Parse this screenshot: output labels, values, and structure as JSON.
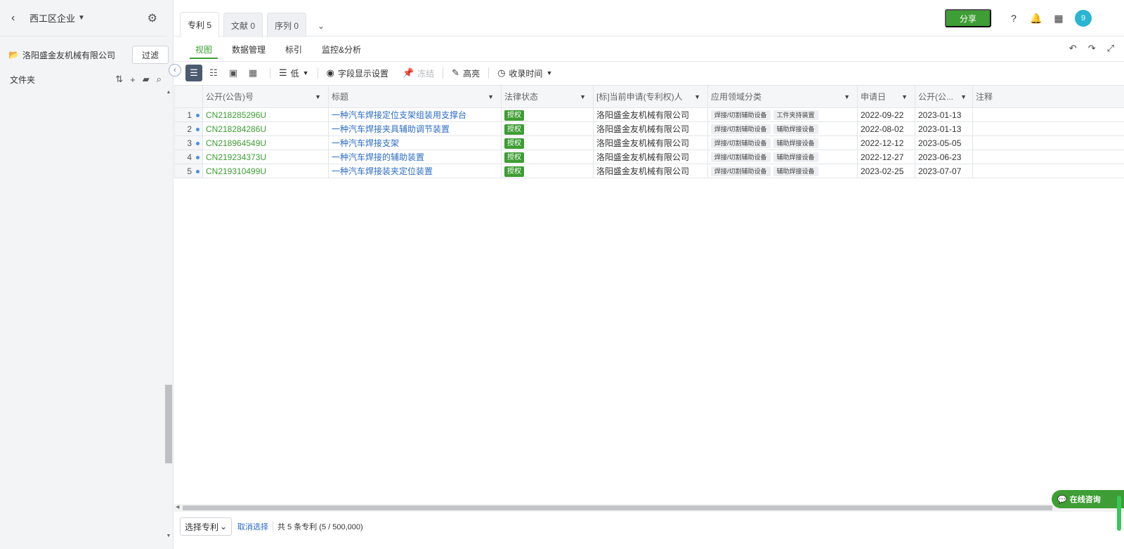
{
  "sidebar": {
    "workspace_title": "西工区企业",
    "company_name": "洛阳盛金友机械有限公司",
    "filter_label": "过滤",
    "folder_label": "文件夹"
  },
  "tabs": [
    {
      "label": "专利 5"
    },
    {
      "label": "文献 0"
    },
    {
      "label": "序列 0"
    }
  ],
  "topbar": {
    "share_label": "分享",
    "avatar_text": "9"
  },
  "subnav": [
    {
      "label": "视图"
    },
    {
      "label": "数据管理"
    },
    {
      "label": "标引"
    },
    {
      "label": "监控&分析"
    }
  ],
  "toolbar": {
    "density_label": "低",
    "fields_label": "字段显示设置",
    "freeze_label": "冻结",
    "highlight_label": "高亮",
    "sort_label": "收录时间"
  },
  "table": {
    "headers": [
      "公开(公告)号",
      "标题",
      "法律状态",
      "[标]当前申请(专利权)人",
      "应用领域分类",
      "申请日",
      "公开(公...",
      "注释"
    ],
    "rows": [
      {
        "num": "1",
        "pn": "CN218285296U",
        "title": "一种汽车焊接定位支架组装用支撑台",
        "status": "授权",
        "applicant": "洛阳盛金友机械有限公司",
        "tag1": "焊接/切割辅助设备",
        "tag2": "工件夹持装置",
        "app_date": "2022-09-22",
        "pub_date": "2023-01-13"
      },
      {
        "num": "2",
        "pn": "CN218284286U",
        "title": "一种汽车焊接夹具辅助调节装置",
        "status": "授权",
        "applicant": "洛阳盛金友机械有限公司",
        "tag1": "焊接/切割辅助设备",
        "tag2": "辅助焊接设备",
        "app_date": "2022-08-02",
        "pub_date": "2023-01-13"
      },
      {
        "num": "3",
        "pn": "CN218964549U",
        "title": "一种汽车焊接支架",
        "status": "授权",
        "applicant": "洛阳盛金友机械有限公司",
        "tag1": "焊接/切割辅助设备",
        "tag2": "辅助焊接设备",
        "app_date": "2022-12-12",
        "pub_date": "2023-05-05"
      },
      {
        "num": "4",
        "pn": "CN219234373U",
        "title": "一种汽车焊接的辅助装置",
        "status": "授权",
        "applicant": "洛阳盛金友机械有限公司",
        "tag1": "焊接/切割辅助设备",
        "tag2": "辅助焊接设备",
        "app_date": "2022-12-27",
        "pub_date": "2023-06-23"
      },
      {
        "num": "5",
        "pn": "CN219310499U",
        "title": "一种汽车焊接装夹定位装置",
        "status": "授权",
        "applicant": "洛阳盛金友机械有限公司",
        "tag1": "焊接/切割辅助设备",
        "tag2": "辅助焊接设备",
        "app_date": "2023-02-25",
        "pub_date": "2023-07-07"
      }
    ]
  },
  "footer": {
    "select_label": "选择专利",
    "cancel_label": "取消选择",
    "total_label": "共 5 条专利 (5 / 500,000)"
  },
  "chat": {
    "label": "在线咨询"
  },
  "colors": {
    "accent": "#3e9d34",
    "link": "#2c6cc4",
    "avatar": "#2ab5d1"
  }
}
